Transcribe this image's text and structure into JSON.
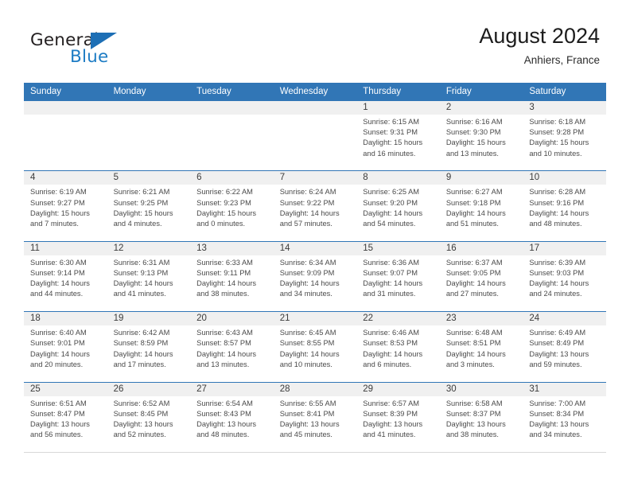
{
  "brand": {
    "name_top": "General",
    "name_bottom": "Blue",
    "flag_icon": "triangle-flag-icon"
  },
  "header": {
    "title": "August 2024",
    "location": "Anhiers, France"
  },
  "calendar": {
    "weekdays": [
      "Sunday",
      "Monday",
      "Tuesday",
      "Wednesday",
      "Thursday",
      "Friday",
      "Saturday"
    ],
    "header_color": "#3176b6",
    "band_color": "#f0f0f0",
    "weeks": [
      [
        {
          "day": "",
          "empty": true
        },
        {
          "day": "",
          "empty": true
        },
        {
          "day": "",
          "empty": true
        },
        {
          "day": "",
          "empty": true
        },
        {
          "day": "1",
          "sunrise": "Sunrise: 6:15 AM",
          "sunset": "Sunset: 9:31 PM",
          "daylight_1": "Daylight: 15 hours",
          "daylight_2": "and 16 minutes."
        },
        {
          "day": "2",
          "sunrise": "Sunrise: 6:16 AM",
          "sunset": "Sunset: 9:30 PM",
          "daylight_1": "Daylight: 15 hours",
          "daylight_2": "and 13 minutes."
        },
        {
          "day": "3",
          "sunrise": "Sunrise: 6:18 AM",
          "sunset": "Sunset: 9:28 PM",
          "daylight_1": "Daylight: 15 hours",
          "daylight_2": "and 10 minutes."
        }
      ],
      [
        {
          "day": "4",
          "sunrise": "Sunrise: 6:19 AM",
          "sunset": "Sunset: 9:27 PM",
          "daylight_1": "Daylight: 15 hours",
          "daylight_2": "and 7 minutes."
        },
        {
          "day": "5",
          "sunrise": "Sunrise: 6:21 AM",
          "sunset": "Sunset: 9:25 PM",
          "daylight_1": "Daylight: 15 hours",
          "daylight_2": "and 4 minutes."
        },
        {
          "day": "6",
          "sunrise": "Sunrise: 6:22 AM",
          "sunset": "Sunset: 9:23 PM",
          "daylight_1": "Daylight: 15 hours",
          "daylight_2": "and 0 minutes."
        },
        {
          "day": "7",
          "sunrise": "Sunrise: 6:24 AM",
          "sunset": "Sunset: 9:22 PM",
          "daylight_1": "Daylight: 14 hours",
          "daylight_2": "and 57 minutes."
        },
        {
          "day": "8",
          "sunrise": "Sunrise: 6:25 AM",
          "sunset": "Sunset: 9:20 PM",
          "daylight_1": "Daylight: 14 hours",
          "daylight_2": "and 54 minutes."
        },
        {
          "day": "9",
          "sunrise": "Sunrise: 6:27 AM",
          "sunset": "Sunset: 9:18 PM",
          "daylight_1": "Daylight: 14 hours",
          "daylight_2": "and 51 minutes."
        },
        {
          "day": "10",
          "sunrise": "Sunrise: 6:28 AM",
          "sunset": "Sunset: 9:16 PM",
          "daylight_1": "Daylight: 14 hours",
          "daylight_2": "and 48 minutes."
        }
      ],
      [
        {
          "day": "11",
          "sunrise": "Sunrise: 6:30 AM",
          "sunset": "Sunset: 9:14 PM",
          "daylight_1": "Daylight: 14 hours",
          "daylight_2": "and 44 minutes."
        },
        {
          "day": "12",
          "sunrise": "Sunrise: 6:31 AM",
          "sunset": "Sunset: 9:13 PM",
          "daylight_1": "Daylight: 14 hours",
          "daylight_2": "and 41 minutes."
        },
        {
          "day": "13",
          "sunrise": "Sunrise: 6:33 AM",
          "sunset": "Sunset: 9:11 PM",
          "daylight_1": "Daylight: 14 hours",
          "daylight_2": "and 38 minutes."
        },
        {
          "day": "14",
          "sunrise": "Sunrise: 6:34 AM",
          "sunset": "Sunset: 9:09 PM",
          "daylight_1": "Daylight: 14 hours",
          "daylight_2": "and 34 minutes."
        },
        {
          "day": "15",
          "sunrise": "Sunrise: 6:36 AM",
          "sunset": "Sunset: 9:07 PM",
          "daylight_1": "Daylight: 14 hours",
          "daylight_2": "and 31 minutes."
        },
        {
          "day": "16",
          "sunrise": "Sunrise: 6:37 AM",
          "sunset": "Sunset: 9:05 PM",
          "daylight_1": "Daylight: 14 hours",
          "daylight_2": "and 27 minutes."
        },
        {
          "day": "17",
          "sunrise": "Sunrise: 6:39 AM",
          "sunset": "Sunset: 9:03 PM",
          "daylight_1": "Daylight: 14 hours",
          "daylight_2": "and 24 minutes."
        }
      ],
      [
        {
          "day": "18",
          "sunrise": "Sunrise: 6:40 AM",
          "sunset": "Sunset: 9:01 PM",
          "daylight_1": "Daylight: 14 hours",
          "daylight_2": "and 20 minutes."
        },
        {
          "day": "19",
          "sunrise": "Sunrise: 6:42 AM",
          "sunset": "Sunset: 8:59 PM",
          "daylight_1": "Daylight: 14 hours",
          "daylight_2": "and 17 minutes."
        },
        {
          "day": "20",
          "sunrise": "Sunrise: 6:43 AM",
          "sunset": "Sunset: 8:57 PM",
          "daylight_1": "Daylight: 14 hours",
          "daylight_2": "and 13 minutes."
        },
        {
          "day": "21",
          "sunrise": "Sunrise: 6:45 AM",
          "sunset": "Sunset: 8:55 PM",
          "daylight_1": "Daylight: 14 hours",
          "daylight_2": "and 10 minutes."
        },
        {
          "day": "22",
          "sunrise": "Sunrise: 6:46 AM",
          "sunset": "Sunset: 8:53 PM",
          "daylight_1": "Daylight: 14 hours",
          "daylight_2": "and 6 minutes."
        },
        {
          "day": "23",
          "sunrise": "Sunrise: 6:48 AM",
          "sunset": "Sunset: 8:51 PM",
          "daylight_1": "Daylight: 14 hours",
          "daylight_2": "and 3 minutes."
        },
        {
          "day": "24",
          "sunrise": "Sunrise: 6:49 AM",
          "sunset": "Sunset: 8:49 PM",
          "daylight_1": "Daylight: 13 hours",
          "daylight_2": "and 59 minutes."
        }
      ],
      [
        {
          "day": "25",
          "sunrise": "Sunrise: 6:51 AM",
          "sunset": "Sunset: 8:47 PM",
          "daylight_1": "Daylight: 13 hours",
          "daylight_2": "and 56 minutes."
        },
        {
          "day": "26",
          "sunrise": "Sunrise: 6:52 AM",
          "sunset": "Sunset: 8:45 PM",
          "daylight_1": "Daylight: 13 hours",
          "daylight_2": "and 52 minutes."
        },
        {
          "day": "27",
          "sunrise": "Sunrise: 6:54 AM",
          "sunset": "Sunset: 8:43 PM",
          "daylight_1": "Daylight: 13 hours",
          "daylight_2": "and 48 minutes."
        },
        {
          "day": "28",
          "sunrise": "Sunrise: 6:55 AM",
          "sunset": "Sunset: 8:41 PM",
          "daylight_1": "Daylight: 13 hours",
          "daylight_2": "and 45 minutes."
        },
        {
          "day": "29",
          "sunrise": "Sunrise: 6:57 AM",
          "sunset": "Sunset: 8:39 PM",
          "daylight_1": "Daylight: 13 hours",
          "daylight_2": "and 41 minutes."
        },
        {
          "day": "30",
          "sunrise": "Sunrise: 6:58 AM",
          "sunset": "Sunset: 8:37 PM",
          "daylight_1": "Daylight: 13 hours",
          "daylight_2": "and 38 minutes."
        },
        {
          "day": "31",
          "sunrise": "Sunrise: 7:00 AM",
          "sunset": "Sunset: 8:34 PM",
          "daylight_1": "Daylight: 13 hours",
          "daylight_2": "and 34 minutes."
        }
      ]
    ]
  }
}
